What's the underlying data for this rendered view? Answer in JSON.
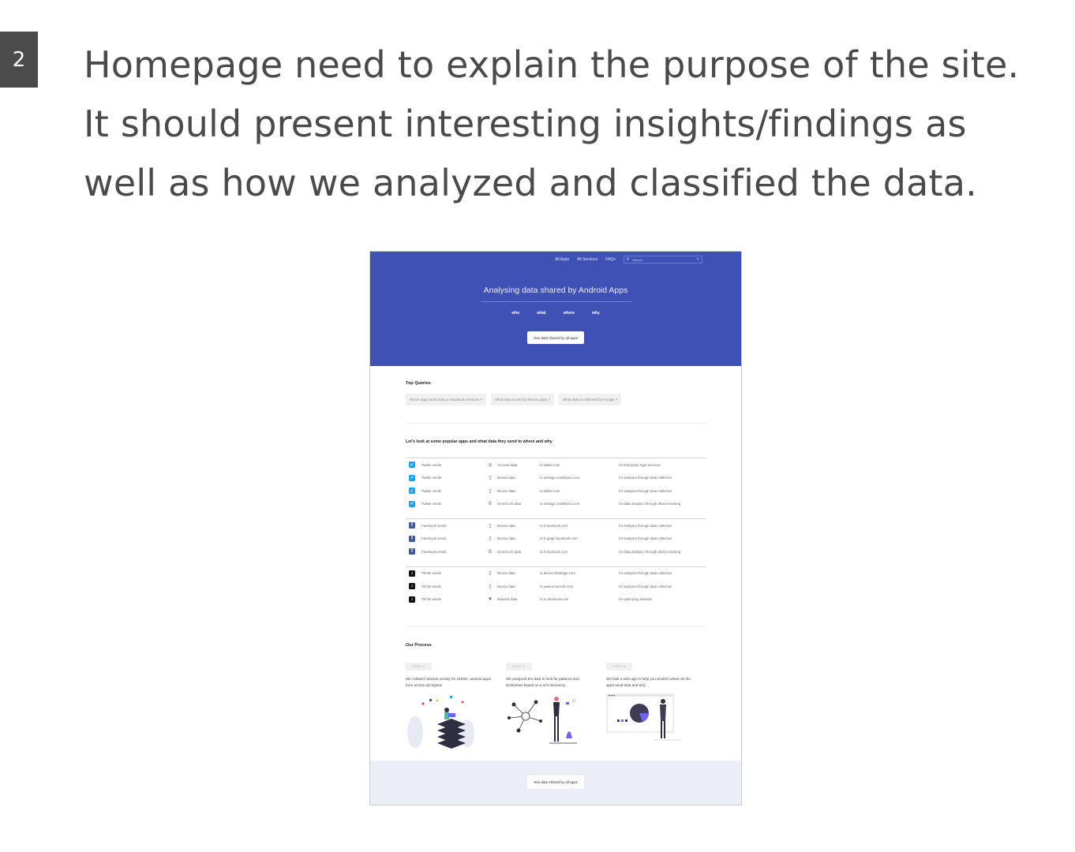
{
  "badge": "2",
  "intro_lines": [
    "Homepage need to explain the purpose of the site.",
    "It should present interesting insights/findings as",
    "well as how we analyzed and classified the data."
  ],
  "mockup": {
    "nav": {
      "links": [
        "All Apps",
        "All Services",
        "FAQs"
      ],
      "search_placeholder": "Search",
      "search_icon": "search-icon",
      "clear_icon": "close-icon"
    },
    "hero": {
      "title": "Analysing data shared by Android Apps",
      "tabs": [
        "who",
        "what",
        "where",
        "why"
      ],
      "button": "See data shared by all apps",
      "color": "#3f51b5"
    },
    "top_queries": {
      "heading": "Top Queries",
      "chips": [
        "Which apps send data to Facebook services ?",
        "What data is sent by fitness apps ?",
        "What data is collected by Google ?"
      ]
    },
    "popular": {
      "heading": "Let's look at some popular apps and what data they send to where and why",
      "groups": [
        {
          "rows": [
            {
              "app": "Twitter sends",
              "icon": "twitter-icon",
              "type_icon": "account-icon",
              "type_glyph": "◎",
              "type": "Account data",
              "dest": "to twitter.com",
              "why": "for third-party login services"
            },
            {
              "app": "Twitter sends",
              "icon": "twitter-icon",
              "type_icon": "device-icon",
              "type_glyph": "▯",
              "type": "Device data",
              "dest": "to settings.crashlytics.com",
              "why": "for analytics through data collection"
            },
            {
              "app": "Twitter sends",
              "icon": "twitter-icon",
              "type_icon": "device-icon",
              "type_glyph": "▯",
              "type": "Device data",
              "dest": "to twitter.com",
              "why": "for analytics through data collection"
            },
            {
              "app": "Twitter sends",
              "icon": "twitter-icon",
              "type_icon": "phone-icon",
              "type_glyph": "✆",
              "type": "Generic ID data",
              "dest": "to settings.crashlytics.com",
              "why": "for data analytics through device tracking"
            }
          ]
        },
        {
          "rows": [
            {
              "app": "Facebook sends",
              "icon": "facebook-icon",
              "type_icon": "device-icon",
              "type_glyph": "▯",
              "type": "Device data",
              "dest": "to h.facebook.com",
              "why": "for analytics through data collection"
            },
            {
              "app": "Facebook sends",
              "icon": "facebook-icon",
              "type_icon": "device-icon",
              "type_glyph": "▯",
              "type": "Device data",
              "dest": "to b-graph.facebook.com",
              "why": "for analytics through data collection"
            },
            {
              "app": "Facebook sends",
              "icon": "facebook-icon",
              "type_icon": "phone-icon",
              "type_glyph": "✆",
              "type": "Generic ID data",
              "dest": "to h.facebook.com",
              "why": "for data analytics through device tracking"
            }
          ]
        },
        {
          "rows": [
            {
              "app": "TikTok sends",
              "icon": "tiktok-icon",
              "type_icon": "device-icon",
              "type_glyph": "▯",
              "type": "Device data",
              "dest": "to device.tiktokapp.com",
              "why": "for analytics through data collection"
            },
            {
              "app": "TikTok sends",
              "icon": "tiktok-icon",
              "type_icon": "device-icon",
              "type_glyph": "▯",
              "type": "Device data",
              "dest": "to www.esoemob.com",
              "why": "for analytics through data collection"
            },
            {
              "app": "TikTok sends",
              "icon": "tiktok-icon",
              "type_icon": "wifi-icon",
              "type_glyph": "▼",
              "type": "Network data",
              "dest": "to m.facebook.com",
              "why": "for optimizing network"
            }
          ]
        }
      ]
    },
    "process": {
      "heading": "Our Process",
      "steps": [
        {
          "label": "STEP 1",
          "text": "We collated network activity for 16000+ android apps from across all regions",
          "art": "data-stack-illustration"
        },
        {
          "label": "STEP 2",
          "text": "We analyzed the data to look for patterns and similarities based on a rich taxonomy",
          "art": "network-analysis-illustration"
        },
        {
          "label": "STEP 3",
          "text": "We built a web app to help you visulize where do the apps send data and why.",
          "art": "web-app-chart-illustration"
        }
      ]
    },
    "footer_button": "See data shared by all apps"
  }
}
